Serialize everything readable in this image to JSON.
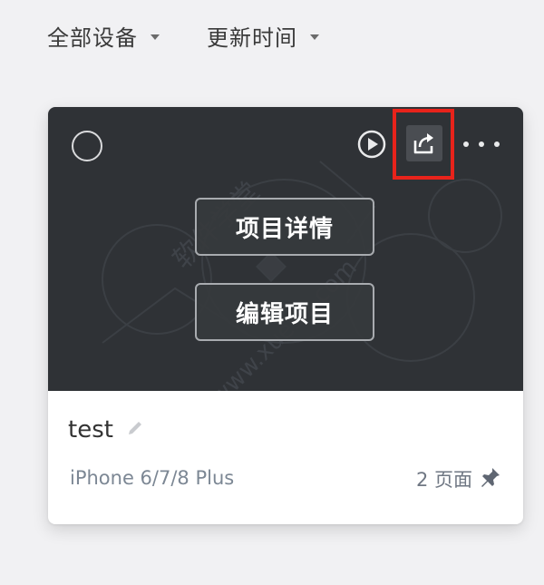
{
  "filters": [
    {
      "label": "全部设备"
    },
    {
      "label": "更新时间"
    }
  ],
  "card": {
    "overlay_buttons": {
      "details": "项目详情",
      "edit": "编辑项目"
    },
    "project_name": "test",
    "device": "iPhone 6/7/8 Plus",
    "pages": "2 页面",
    "watermark_text": "软件学堂 www.xue51.com"
  },
  "colors": {
    "preview_bg": "#2f3236",
    "highlight": "#e8231b"
  },
  "icons": [
    "caret-down-icon",
    "select-circle-icon",
    "play-icon",
    "share-icon",
    "more-icon",
    "edit-pencil-icon",
    "pin-icon"
  ]
}
